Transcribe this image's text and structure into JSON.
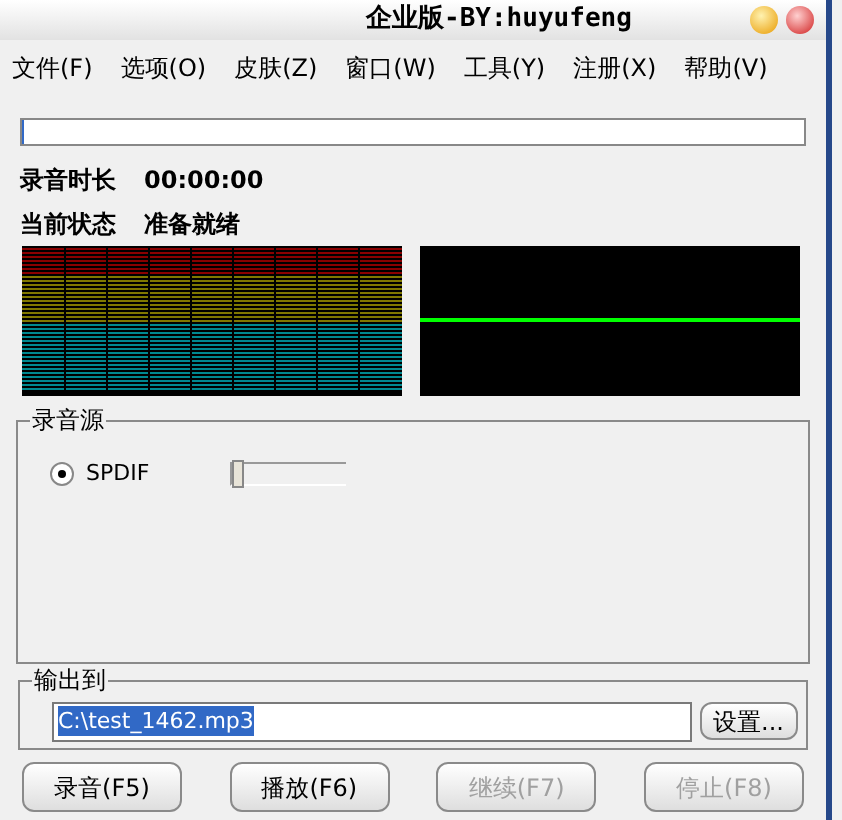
{
  "window": {
    "title": "企业版-BY:huyufeng"
  },
  "menu": [
    {
      "label": "文件(F)"
    },
    {
      "label": "选项(O)"
    },
    {
      "label": "皮肤(Z)"
    },
    {
      "label": "窗口(W)"
    },
    {
      "label": "工具(Y)"
    },
    {
      "label": "注册(X)"
    },
    {
      "label": "帮助(V)"
    }
  ],
  "progress": {
    "level": 0
  },
  "duration": {
    "label": "录音时长",
    "value": "00:00:00"
  },
  "status": {
    "label": "当前状态",
    "value": "准备就绪"
  },
  "source": {
    "title": "录音源",
    "options": [
      {
        "label": "SPDIF",
        "selected": true,
        "level": 0
      }
    ]
  },
  "output": {
    "title": "输出到",
    "value": "C:\\test_1462.mp3",
    "button": "设置..."
  },
  "buttons": [
    {
      "label": "录音(F5)",
      "disabled": false
    },
    {
      "label": "播放(F6)",
      "disabled": false
    },
    {
      "label": "继续(F7)",
      "disabled": true
    },
    {
      "label": "停止(F8)",
      "disabled": true
    }
  ]
}
